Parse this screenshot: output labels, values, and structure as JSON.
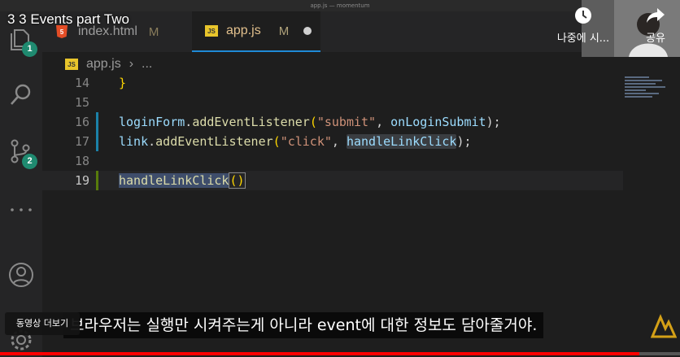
{
  "window": {
    "title": "app.js — momentum"
  },
  "video": {
    "title": "3 3 Events part Two",
    "watch_later_label": "나중에 시...",
    "share_label": "공유",
    "more_videos_label": "동영상 더보기",
    "subtitle": "브라우저는 실행만 시켜주는게 아니라 event에 대한 정보도 담아줄거야.",
    "progress": 0.94
  },
  "activity_bar": {
    "explorer_badge": "1",
    "scm_badge": "2"
  },
  "tabs": [
    {
      "icon": "html-icon",
      "filename": "index.html",
      "status": "M"
    },
    {
      "icon": "js-icon",
      "badge": "JS",
      "filename": "app.js",
      "status": "M",
      "unsaved": true
    }
  ],
  "breadcrumb": {
    "badge": "JS",
    "file": "app.js",
    "separator": "›",
    "more": "..."
  },
  "editor": {
    "lines": [
      {
        "num": "14",
        "code": "}"
      },
      {
        "num": "15",
        "code": ""
      },
      {
        "num": "16",
        "code": "loginForm.addEventListener(\"submit\", onLoginSubmit);"
      },
      {
        "num": "17",
        "code": "link.addEventListener(\"click\", handleLinkClick);"
      },
      {
        "num": "18",
        "code": ""
      },
      {
        "num": "19",
        "code": "handleLinkClick()"
      }
    ],
    "tokens": {
      "l14_brace": "}",
      "l16_obj": "loginForm",
      "l16_dot": ".",
      "l16_fn": "addEventListener",
      "l16_open": "(",
      "l16_str": "\"submit\"",
      "l16_comma": ", ",
      "l16_arg": "onLoginSubmit",
      "l16_close": ");",
      "l17_obj": "link",
      "l17_dot": ".",
      "l17_fn": "addEventListener",
      "l17_open": "(",
      "l17_str": "\"click\"",
      "l17_comma": ", ",
      "l17_arg": "handleLinkClick",
      "l17_close": ");",
      "l19_fn": "handleLinkClick",
      "l19_parens": "()"
    }
  }
}
